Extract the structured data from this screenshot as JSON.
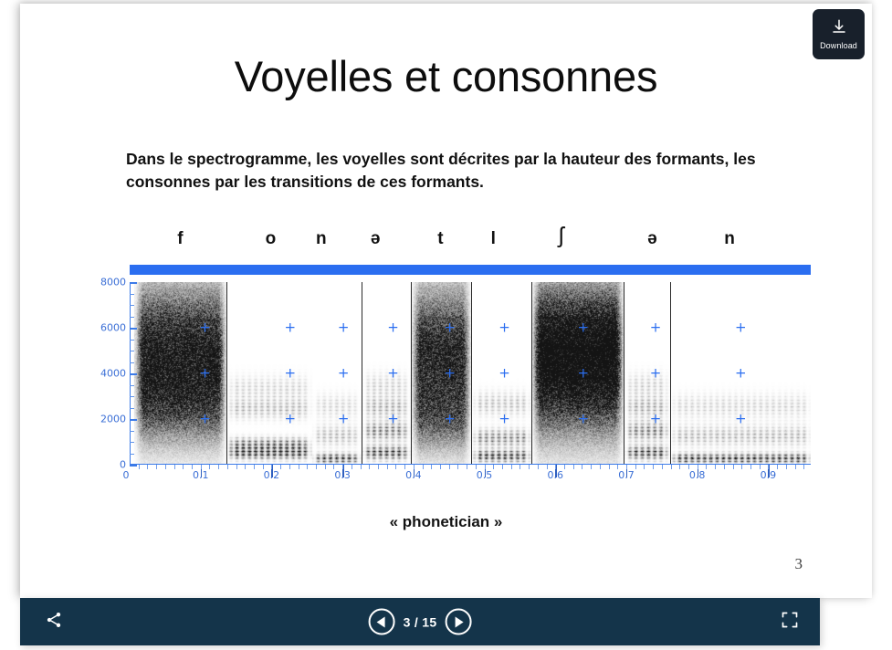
{
  "viewer": {
    "download": {
      "label": "Download",
      "icon": "download-icon"
    },
    "toolbar": {
      "share_icon": "share-icon",
      "prev_label": "previous-slide",
      "next_label": "next-slide",
      "page_counter": "3 / 15",
      "current_page": 3,
      "total_pages": 15,
      "fullscreen_icon": "fullscreen-icon"
    }
  },
  "slide": {
    "title": "Voyelles et consonnes",
    "subtitle": "Dans le spectrogramme, les voyelles sont décrites par la hauteur des formants, les consonnes par les transitions de ces formants.",
    "caption": "« phonetician »",
    "number": "3"
  },
  "chart_data": {
    "type": "heatmap",
    "title": "",
    "xlabel": "",
    "ylabel": "",
    "xlim": [
      0,
      0.96
    ],
    "ylim": [
      0,
      8000
    ],
    "grid": false,
    "x_ticks": [
      "0",
      "0.1",
      "0.2",
      "0.3",
      "0.4",
      "0.5",
      "0.6",
      "0.7",
      "0.8",
      "0.9"
    ],
    "x_tick_values": [
      0,
      0.1,
      0.2,
      0.3,
      0.4,
      0.5,
      0.6,
      0.7,
      0.8,
      0.9
    ],
    "y_ticks": [
      "0",
      "2000",
      "4000",
      "6000",
      "8000"
    ],
    "y_tick_values": [
      0,
      2000,
      4000,
      6000,
      8000
    ],
    "phones": [
      {
        "symbol": "f",
        "start": 0.005,
        "end": 0.135,
        "label_x": 0.07,
        "type": "consonant"
      },
      {
        "symbol": "o",
        "start": 0.135,
        "end": 0.255,
        "label_x": 0.195,
        "type": "vowel"
      },
      {
        "symbol": "n",
        "start": 0.255,
        "end": 0.325,
        "label_x": 0.265,
        "type": "consonant"
      },
      {
        "symbol": "ə",
        "start": 0.325,
        "end": 0.395,
        "label_x": 0.34,
        "type": "vowel"
      },
      {
        "symbol": "t",
        "start": 0.395,
        "end": 0.48,
        "label_x": 0.43,
        "type": "consonant"
      },
      {
        "symbol": "l",
        "start": 0.48,
        "end": 0.565,
        "label_x": 0.503,
        "type": "consonant"
      },
      {
        "symbol": "ʃ",
        "start": 0.565,
        "end": 0.695,
        "label_x": 0.597,
        "type": "consonant"
      },
      {
        "symbol": "ə",
        "start": 0.695,
        "end": 0.76,
        "label_x": 0.723,
        "type": "vowel"
      },
      {
        "symbol": "n",
        "start": 0.76,
        "end": 0.96,
        "label_x": 0.83,
        "type": "consonant"
      }
    ],
    "segment_boundaries": [
      0.135,
      0.325,
      0.395,
      0.48,
      0.565,
      0.695,
      0.76
    ],
    "formant_markers": {
      "frequencies": [
        2000,
        4000,
        6000
      ],
      "times": [
        0.105,
        0.225,
        0.3,
        0.37,
        0.45,
        0.527,
        0.638,
        0.74,
        0.86
      ]
    },
    "colors": {
      "axis": "#3b7ae8",
      "tick_text": "#3b6fd6",
      "topbar": "#2b6ef0",
      "marker": "#2b6ef0",
      "segment_line": "#2a2a2a",
      "spectro_ink": "#3a3a3a"
    }
  }
}
